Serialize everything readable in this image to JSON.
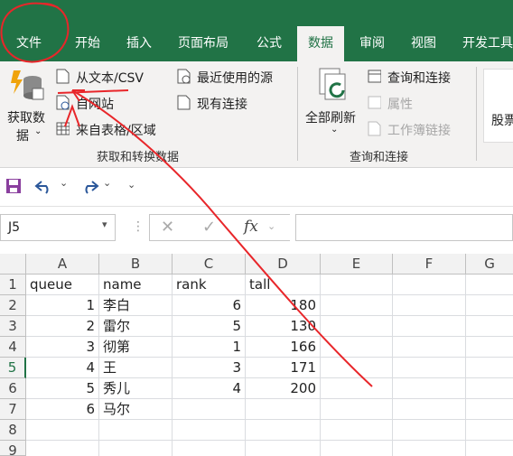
{
  "tabs": [
    "文件",
    "开始",
    "插入",
    "页面布局",
    "公式",
    "数据",
    "审阅",
    "视图",
    "开发工具"
  ],
  "ribbon": {
    "get_data": [
      "获取数",
      "据"
    ],
    "from_text_csv": "从文本/CSV",
    "from_web": "自网站",
    "from_table": "来自表格/区域",
    "recent_sources": "最近使用的源",
    "existing_connections": "现有连接",
    "group_get_transform": "获取和转换数据",
    "refresh_all": "全部刷新",
    "queries_connections": "查询和连接",
    "properties": "属性",
    "edit_links": "工作簿链接",
    "group_queries": "查询和连接",
    "stocks_partial": "股票"
  },
  "namebox": "J5",
  "formula_value": "",
  "columns": [
    "A",
    "B",
    "C",
    "D",
    "E",
    "F",
    "G"
  ],
  "rows": [
    "1",
    "2",
    "3",
    "4",
    "5",
    "6",
    "7",
    "8",
    "9"
  ],
  "cells": {
    "r1": [
      "queue",
      "name",
      "rank",
      "tall"
    ],
    "r2": [
      "1",
      "李白",
      "6",
      "180"
    ],
    "r3": [
      "2",
      "雷尔",
      "5",
      "130"
    ],
    "r4": [
      "3",
      "彻第",
      "1",
      "166"
    ],
    "r5": [
      "4",
      "王",
      "3",
      "171"
    ],
    "r6": [
      "5",
      "秀儿",
      "4",
      "200"
    ],
    "r7": [
      "6",
      "马尔",
      "",
      ""
    ]
  },
  "colors": {
    "excel_green": "#217346",
    "annotation_red": "#e8262a"
  }
}
